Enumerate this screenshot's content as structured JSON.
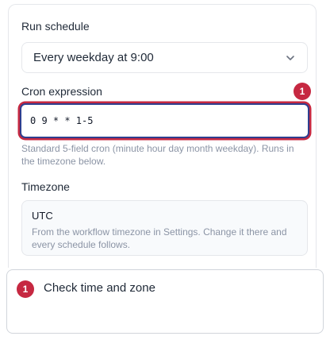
{
  "schedule": {
    "run_label": "Run schedule",
    "run_value": "Every weekday at 9:00",
    "cron_label": "Cron expression",
    "cron_value": "0 9 * * 1-5",
    "cron_help": "Standard 5-field cron (minute hour day month weekday). Runs in the timezone below.",
    "timezone_label": "Timezone",
    "timezone_value": "UTC",
    "timezone_note": "From the workflow timezone in Settings. Change it there and every schedule follows."
  },
  "annotation": {
    "badge": "1",
    "text": "Check time and zone",
    "color": "#c62841"
  },
  "icons": {
    "select": "chevron-down-icon"
  }
}
